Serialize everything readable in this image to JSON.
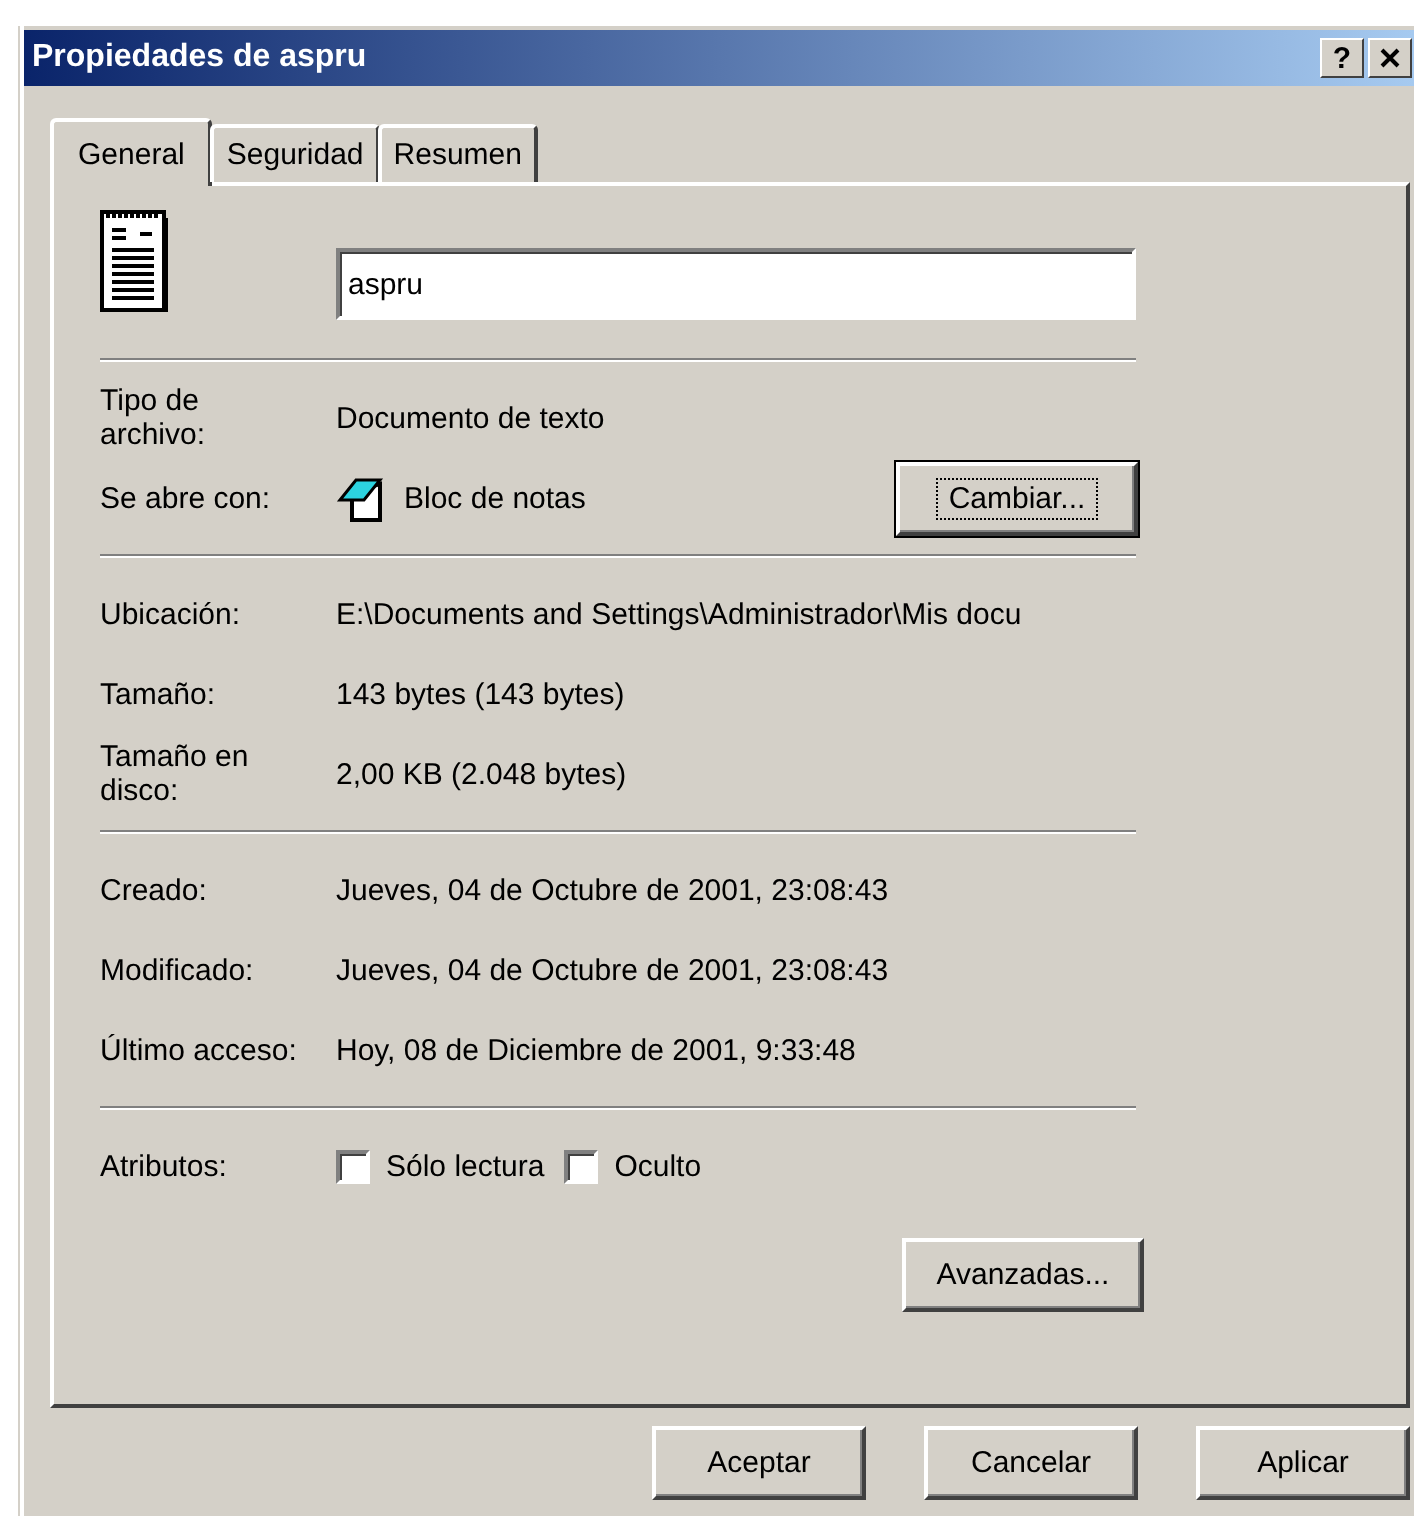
{
  "window": {
    "title": "Propiedades de aspru",
    "title_buttons": [
      {
        "kind": "help",
        "label": "?"
      },
      {
        "kind": "close"
      }
    ]
  },
  "tabs": [
    {
      "label": "General",
      "selected": true
    },
    {
      "label": "Seguridad",
      "selected": false
    },
    {
      "label": "Resumen",
      "selected": false
    }
  ],
  "file_name": {
    "value": "aspru"
  },
  "sections": [
    [
      {
        "kind": "text",
        "label": "Tipo de archivo:",
        "value": "Documento de texto"
      },
      {
        "kind": "app",
        "label": "Se abre con:",
        "value": "Bloc de notas",
        "button": "Cambiar..."
      }
    ],
    [
      {
        "kind": "text",
        "label": "Ubicación:",
        "value": "E:\\Documents and Settings\\Administrador\\Mis docu"
      },
      {
        "kind": "text",
        "label": "Tamaño:",
        "value": "143 bytes (143 bytes)"
      },
      {
        "kind": "text",
        "label": "Tamaño en disco:",
        "value": "2,00 KB (2.048 bytes)"
      }
    ],
    [
      {
        "kind": "text",
        "label": "Creado:",
        "value": "Jueves, 04 de Octubre de 2001, 23:08:43"
      },
      {
        "kind": "text",
        "label": "Modificado:",
        "value": "Jueves, 04 de Octubre de 2001, 23:08:43"
      },
      {
        "kind": "text",
        "label": "Último acceso:",
        "value": "Hoy, 08 de Diciembre de 2001, 9:33:48"
      }
    ],
    [
      {
        "kind": "attributes",
        "label": "Atributos:",
        "checkboxes": [
          {
            "label": "Sólo lectura",
            "checked": false
          },
          {
            "label": "Oculto",
            "checked": false
          }
        ]
      }
    ]
  ],
  "advanced_button": "Avanzadas...",
  "buttons": [
    "Aceptar",
    "Cancelar",
    "Aplicar"
  ]
}
